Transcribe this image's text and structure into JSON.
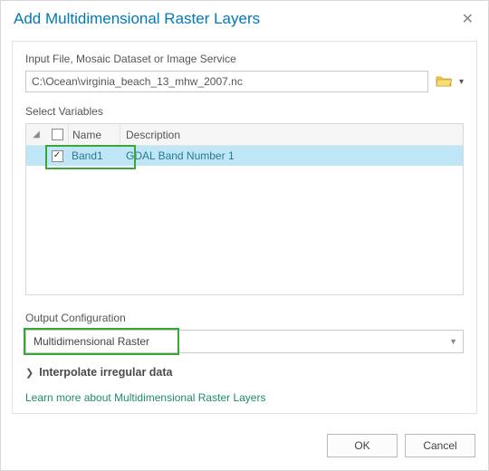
{
  "title": "Add Multidimensional Raster Layers",
  "inputLabel": "Input File, Mosaic Dataset or Image Service",
  "inputPath": "C:\\Ocean\\virginia_beach_13_mhw_2007.nc",
  "selectVarsLabel": "Select Variables",
  "varsHeader": {
    "name": "Name",
    "desc": "Description"
  },
  "varsRows": [
    {
      "checked": true,
      "name": "Band1",
      "desc": "GDAL Band Number 1"
    }
  ],
  "outputLabel": "Output Configuration",
  "outputValue": "Multidimensional Raster",
  "interpolateLabel": "Interpolate irregular data",
  "learnMore": "Learn more about Multidimensional Raster Layers",
  "buttons": {
    "ok": "OK",
    "cancel": "Cancel"
  }
}
